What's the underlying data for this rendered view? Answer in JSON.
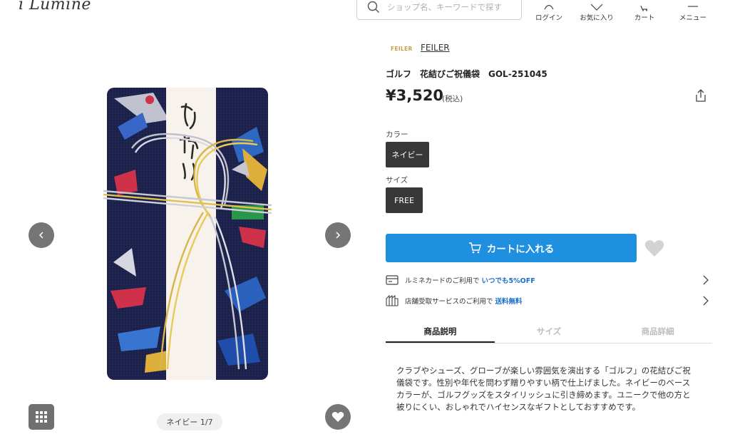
{
  "header": {
    "logo": "i Lumine",
    "search_placeholder": "ショップ名、キーワードで探す",
    "nav": [
      {
        "label": "ログイン",
        "icon": "person-icon"
      },
      {
        "label": "お気に入り",
        "icon": "heart-outline-icon"
      },
      {
        "label": "カート",
        "icon": "cart-icon"
      },
      {
        "label": "メニュー",
        "icon": "menu-icon"
      }
    ]
  },
  "gallery": {
    "image_alt": "お祝い",
    "counter": "ネイビー 1/7"
  },
  "product": {
    "brand_logo": "FEILER",
    "brand_link": "FEILER",
    "title": "ゴルフ　花結びご祝儀袋　GOL-251045",
    "price": "¥3,520",
    "tax_note": "(税込)",
    "color_label": "カラー",
    "color_value": "ネイビー",
    "size_label": "サイズ",
    "size_value": "FREE",
    "cart_button": "カートに入れる",
    "info_rows": [
      {
        "text": "ルミネカードのご利用で",
        "highlight": "いつでも5%OFF",
        "icon": "card-icon"
      },
      {
        "text": "店舗受取サービスのご利用で",
        "highlight": "送料無料",
        "icon": "store-icon"
      }
    ],
    "tabs": [
      "商品説明",
      "サイズ",
      "商品詳細"
    ],
    "description": "クラブやシューズ、グローブが楽しい雰囲気を演出する「ゴルフ」の花結びご祝儀袋です。性別や年代を問わず贈りやすい柄で仕上げました。ネイビーのベースカラーが、ゴルフグッズをスタイリッシュに引き締めます。ユニークで他の方と被りにくい、おしゃれでハイセンスなギフトとしておすすめです。"
  },
  "colors": {
    "accent": "#1f8fe0",
    "brand_gold": "#c9a040",
    "dark_button": "#383838",
    "link_blue": "#1a6fc9"
  }
}
